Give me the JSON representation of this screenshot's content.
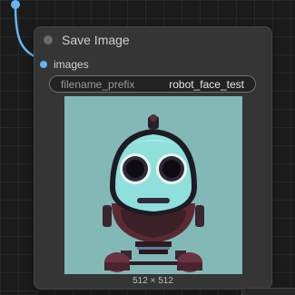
{
  "node": {
    "title": "Save Image",
    "input": {
      "label": "images"
    },
    "widget": {
      "label": "filename_prefix",
      "value": "robot_face_test"
    },
    "preview": {
      "dimensions": "512 × 512",
      "subject": "robot-face-image"
    }
  },
  "colors": {
    "link": "#64b5f6",
    "node_bg": "#353535",
    "canvas_bg": "#1b1b1b",
    "preview_bg": "#82b9b6"
  }
}
